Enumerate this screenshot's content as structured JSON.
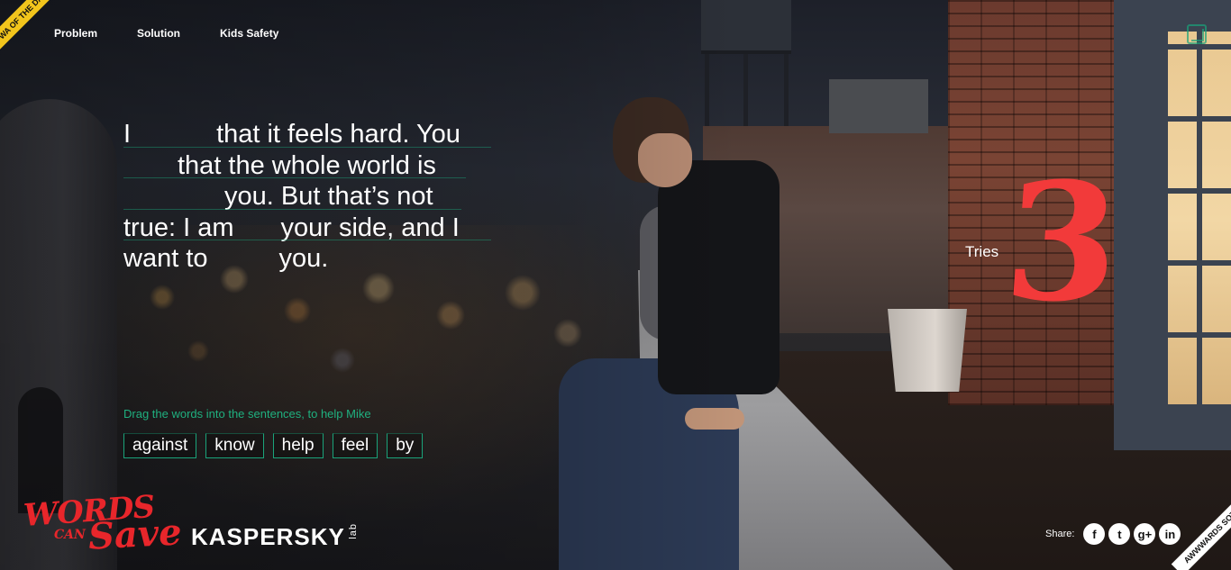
{
  "ribbon": {
    "text": "FWA OF THE DAY"
  },
  "nav": {
    "items": [
      {
        "label": "Problem"
      },
      {
        "label": "Solution"
      },
      {
        "label": "Kids Safety"
      }
    ]
  },
  "passage": {
    "lines": [
      {
        "before": "I",
        "after": "that it feels hard. You"
      },
      {
        "before": "",
        "after": "that the whole world is"
      },
      {
        "before": "",
        "after": "you. But that’s not"
      },
      {
        "before": "true: I am",
        "after": "your side, and I"
      },
      {
        "before": "want to",
        "after": "you."
      }
    ]
  },
  "instructions": "Drag the words into the sentences, to help Mike",
  "words": [
    "against",
    "know",
    "help",
    "feel",
    "by"
  ],
  "tries": {
    "label": "Tries",
    "count": "3"
  },
  "branding": {
    "campaign_line1": "WORDS",
    "campaign_line2": "CAN",
    "campaign_line3": "Save",
    "partner": "KASPERSKY",
    "partner_suffix": "lab"
  },
  "share": {
    "label": "Share:",
    "networks": [
      {
        "icon": "facebook-icon",
        "glyph": "f"
      },
      {
        "icon": "twitter-icon",
        "glyph": "t"
      },
      {
        "icon": "google-plus-icon",
        "glyph": "g+"
      },
      {
        "icon": "linkedin-icon",
        "glyph": "in"
      }
    ]
  },
  "award": {
    "text": "AWWWARDS SOTD"
  },
  "colors": {
    "accent": "#1aa37a",
    "tries": "#f23a3a",
    "brand_red": "#e8262b"
  }
}
